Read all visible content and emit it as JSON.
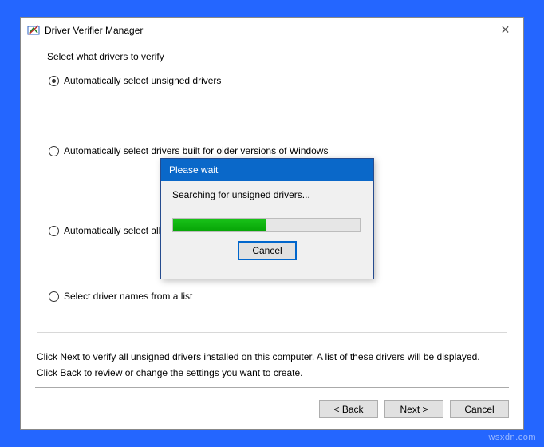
{
  "window": {
    "title": "Driver Verifier Manager",
    "close_glyph": "✕"
  },
  "groupbox": {
    "title": "Select what drivers to verify",
    "options": {
      "unsigned": "Automatically select unsigned drivers",
      "older": "Automatically select drivers built for older versions of Windows",
      "all": "Automatically select all drivers installed on this computer",
      "list": "Select driver names from a list"
    },
    "selected": "unsigned"
  },
  "hints": {
    "line1": "Click Next to verify all unsigned drivers installed on this computer. A list of these drivers will be displayed.",
    "line2": "Click Back to review or change the settings you want to create."
  },
  "footer": {
    "back": "< Back",
    "next": "Next >",
    "cancel": "Cancel"
  },
  "dialog": {
    "title": "Please wait",
    "message": "Searching for unsigned drivers...",
    "progress_percent": 50,
    "cancel": "Cancel"
  },
  "watermark": "wsxdn.com"
}
